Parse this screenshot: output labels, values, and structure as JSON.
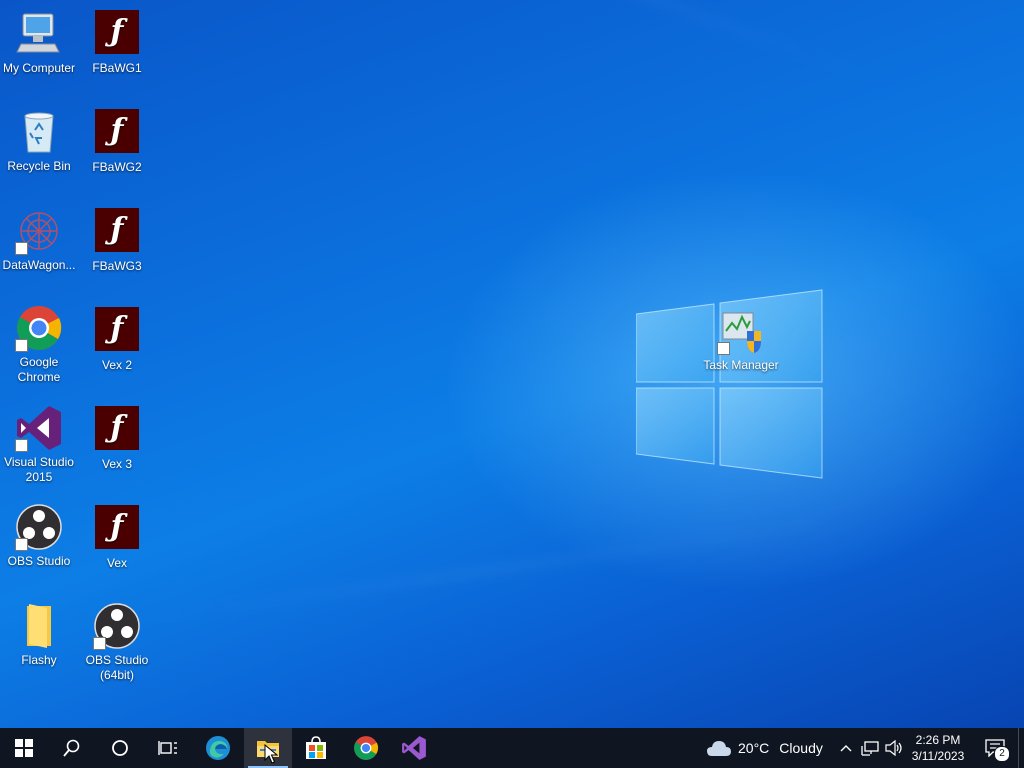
{
  "desktop": {
    "icons": [
      {
        "label": "My Computer"
      },
      {
        "label": "Recycle Bin"
      },
      {
        "label": "DataWagon..."
      },
      {
        "label": "Google Chrome"
      },
      {
        "label": "Visual Studio 2015"
      },
      {
        "label": "OBS Studio"
      },
      {
        "label": "Flashy"
      },
      {
        "label": "FBaWG1"
      },
      {
        "label": "FBaWG2"
      },
      {
        "label": "FBaWG3"
      },
      {
        "label": "Vex 2"
      },
      {
        "label": "Vex 3"
      },
      {
        "label": "Vex"
      },
      {
        "label": "OBS Studio (64bit)"
      },
      {
        "label": "Task Manager"
      }
    ]
  },
  "taskbar": {
    "pinned": [
      {
        "name": "start",
        "icon": "windows-logo-icon"
      },
      {
        "name": "search",
        "icon": "search-icon"
      },
      {
        "name": "cortana",
        "icon": "circle-icon"
      },
      {
        "name": "task-view",
        "icon": "task-view-icon"
      },
      {
        "name": "edge",
        "icon": "edge-icon"
      },
      {
        "name": "file-explorer",
        "icon": "folder-icon",
        "active": true
      },
      {
        "name": "store",
        "icon": "store-icon"
      },
      {
        "name": "chrome",
        "icon": "chrome-icon"
      },
      {
        "name": "visual-studio",
        "icon": "visual-studio-icon"
      }
    ],
    "weather": {
      "temp": "20°C",
      "condition": "Cloudy",
      "icon": "cloud-icon"
    },
    "clock": {
      "time": "2:26 PM",
      "date": "3/11/2023"
    },
    "notifications": {
      "count": "2"
    }
  },
  "colors": {
    "taskbar": "#101621",
    "flash": "#4a0000",
    "accent": "#0b6fdc"
  }
}
